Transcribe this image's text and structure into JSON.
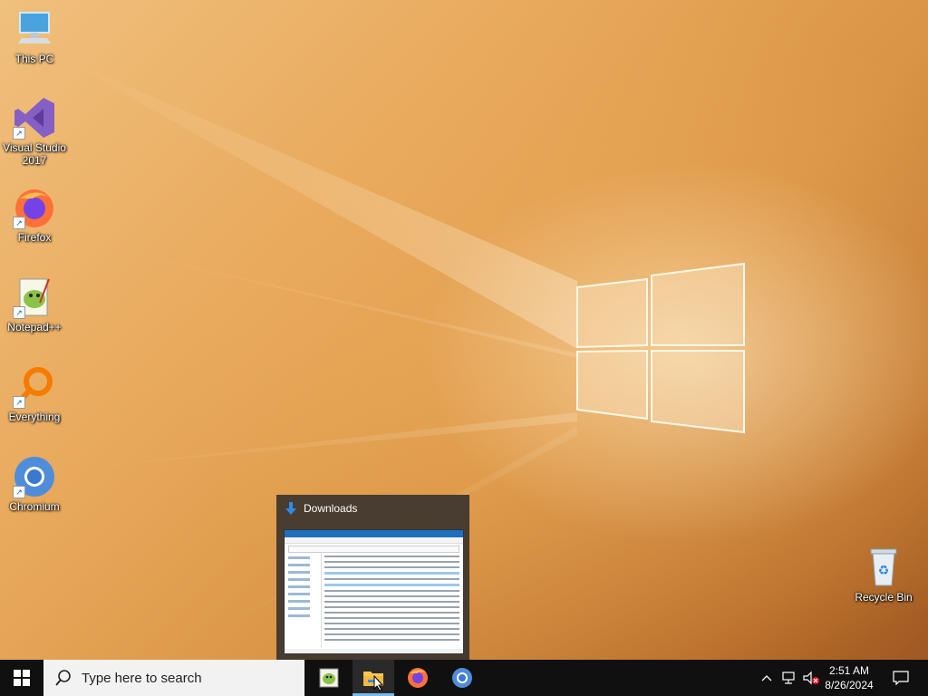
{
  "desktop": {
    "icons": [
      {
        "label": "This PC",
        "icon": "computer-icon"
      },
      {
        "label": "Visual Studio 2017",
        "icon": "visual-studio-icon"
      },
      {
        "label": "Firefox",
        "icon": "firefox-icon"
      },
      {
        "label": "Notepad++",
        "icon": "notepadpp-icon"
      },
      {
        "label": "Everything",
        "icon": "everything-icon"
      },
      {
        "label": "Chromium",
        "icon": "chromium-icon"
      },
      {
        "label": "Recycle Bin",
        "icon": "recycle-bin-icon"
      }
    ]
  },
  "thumbnail": {
    "title": "Downloads",
    "icon": "download-arrow-icon"
  },
  "taskbar": {
    "search_placeholder": "Type here to search",
    "apps": [
      {
        "name": "Notepad++",
        "icon": "notepadpp-icon"
      },
      {
        "name": "File Explorer",
        "icon": "file-explorer-icon",
        "active": true
      },
      {
        "name": "Firefox",
        "icon": "firefox-icon"
      },
      {
        "name": "Chromium",
        "icon": "chromium-icon"
      }
    ],
    "tray": {
      "time": "2:51 AM",
      "date": "8/26/2024"
    }
  },
  "colors": {
    "taskbar": "#101010",
    "active_indicator": "#76b9ed",
    "search_box": "#f2f2f2"
  }
}
